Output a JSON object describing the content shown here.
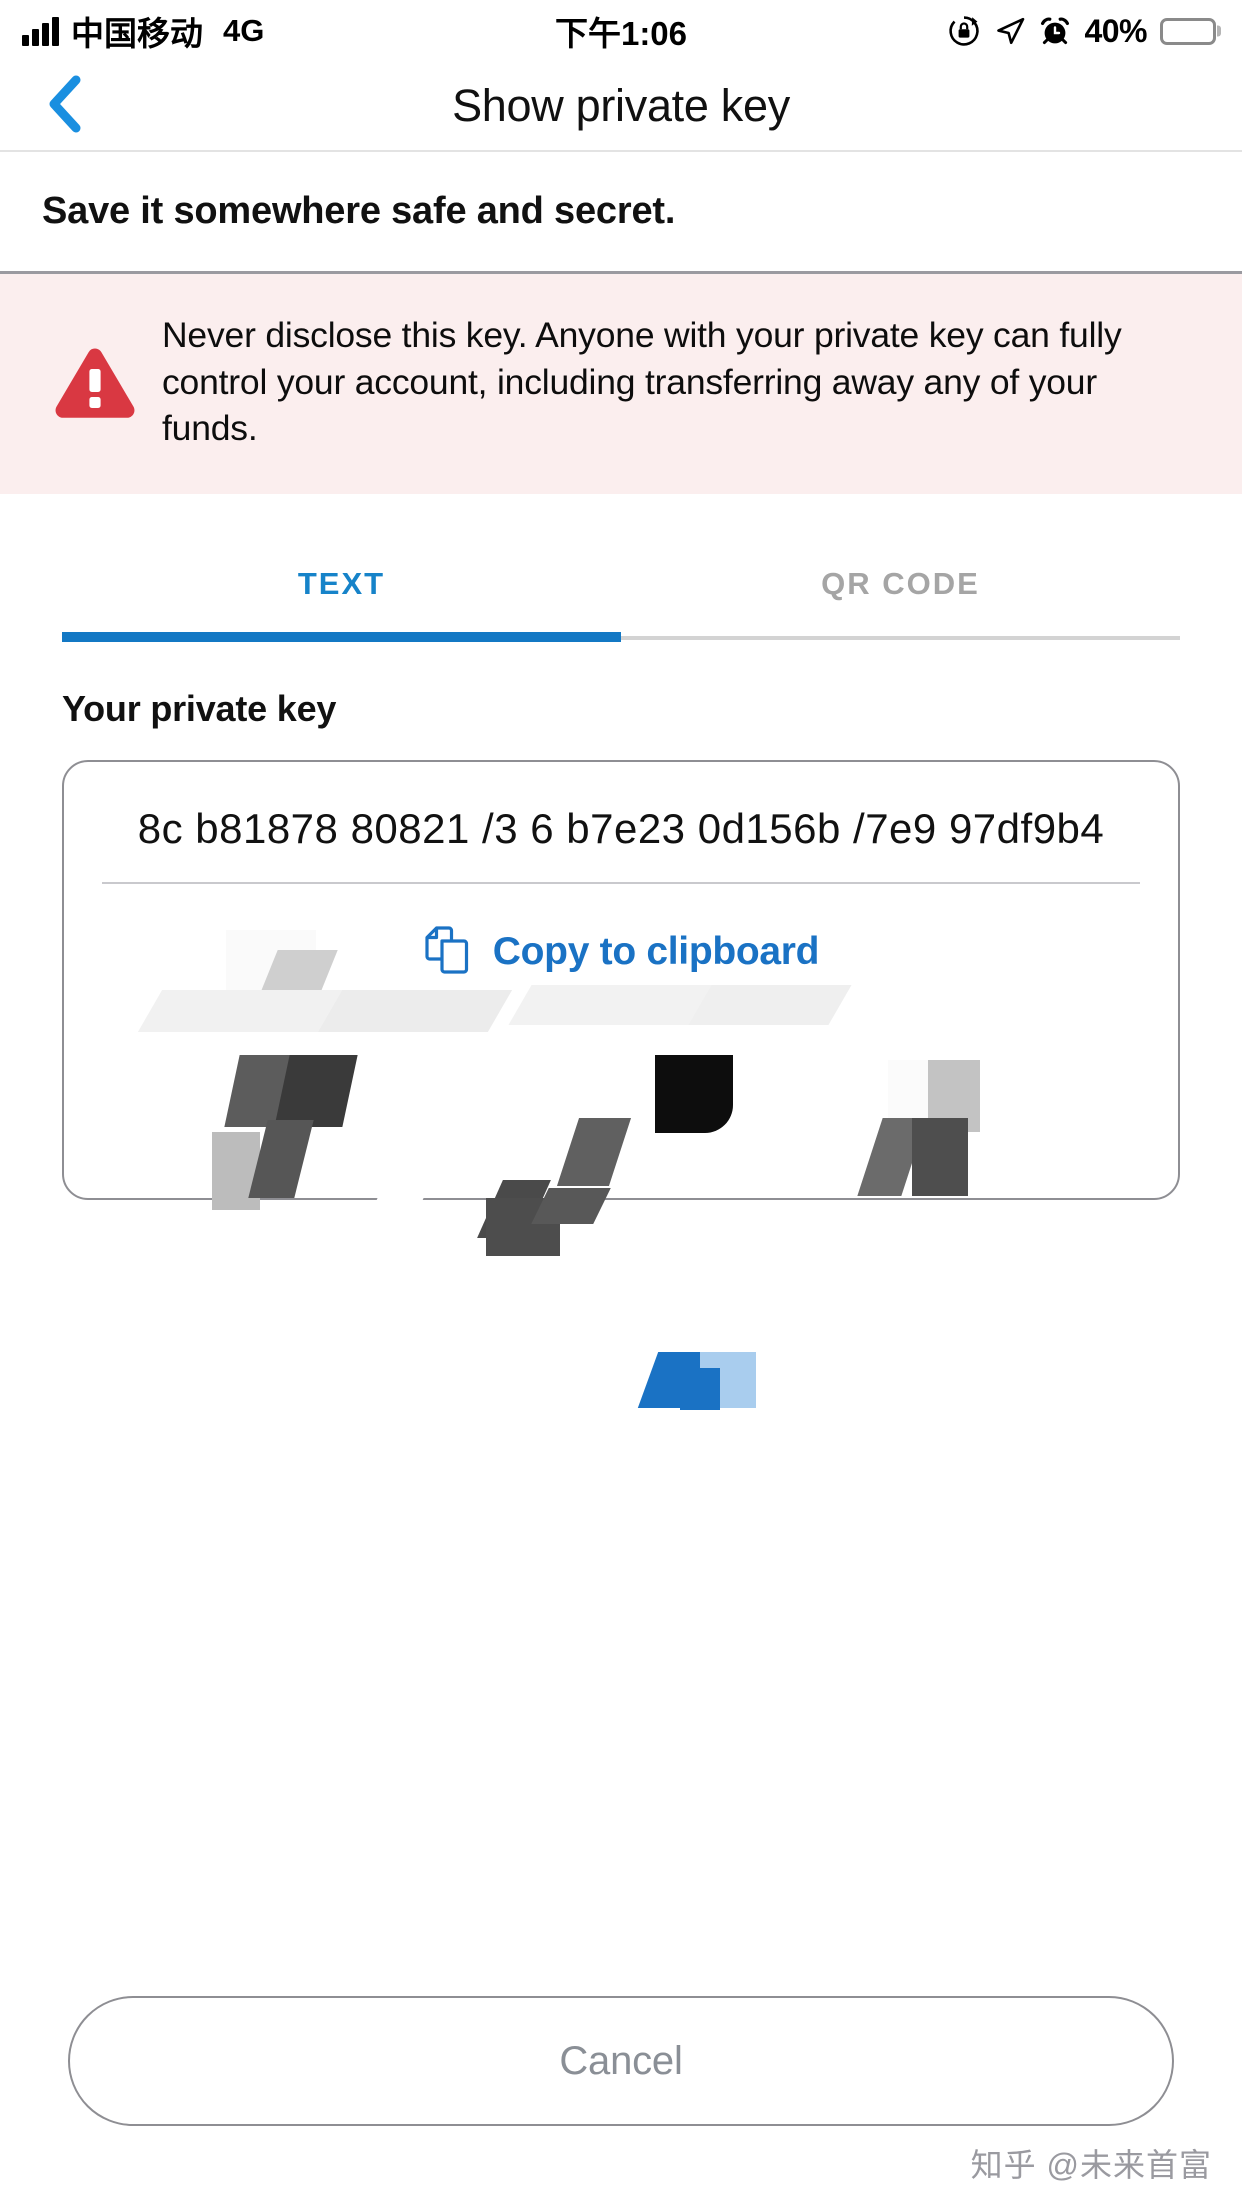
{
  "status_bar": {
    "carrier": "中国移动",
    "network": "4G",
    "time": "下午1:06",
    "battery_percent": "40%",
    "battery_level": 40,
    "icons": [
      "signal-bars-icon",
      "rotation-lock-icon",
      "location-arrow-icon",
      "alarm-clock-icon",
      "battery-icon"
    ]
  },
  "nav": {
    "back_icon": "chevron-left-icon",
    "title": "Show private key"
  },
  "subtitle": "Save it somewhere safe and secret.",
  "warning": {
    "icon": "warning-triangle-icon",
    "text": "Never disclose this key. Anyone with your private key can fully control your account, including transferring away any of your funds.",
    "background": "#fbeeee",
    "icon_color": "#d93842"
  },
  "tabs": {
    "items": [
      {
        "label": "TEXT",
        "active": true
      },
      {
        "label": "QR CODE",
        "active": false
      }
    ],
    "active_color": "#1683c9",
    "inactive_color": "#a5a5a5",
    "indicator_color": "#1378c4"
  },
  "key_panel": {
    "label": "Your private key",
    "value": "8c     b81878    80821    /3 6   b7e23   0d156b   /7e9      97df9b4",
    "copy": {
      "icon": "copy-icon",
      "label": "Copy to clipboard",
      "color": "#1a72c4"
    }
  },
  "footer": {
    "cancel_label": "Cancel"
  },
  "watermark": "知乎 @未来首富"
}
